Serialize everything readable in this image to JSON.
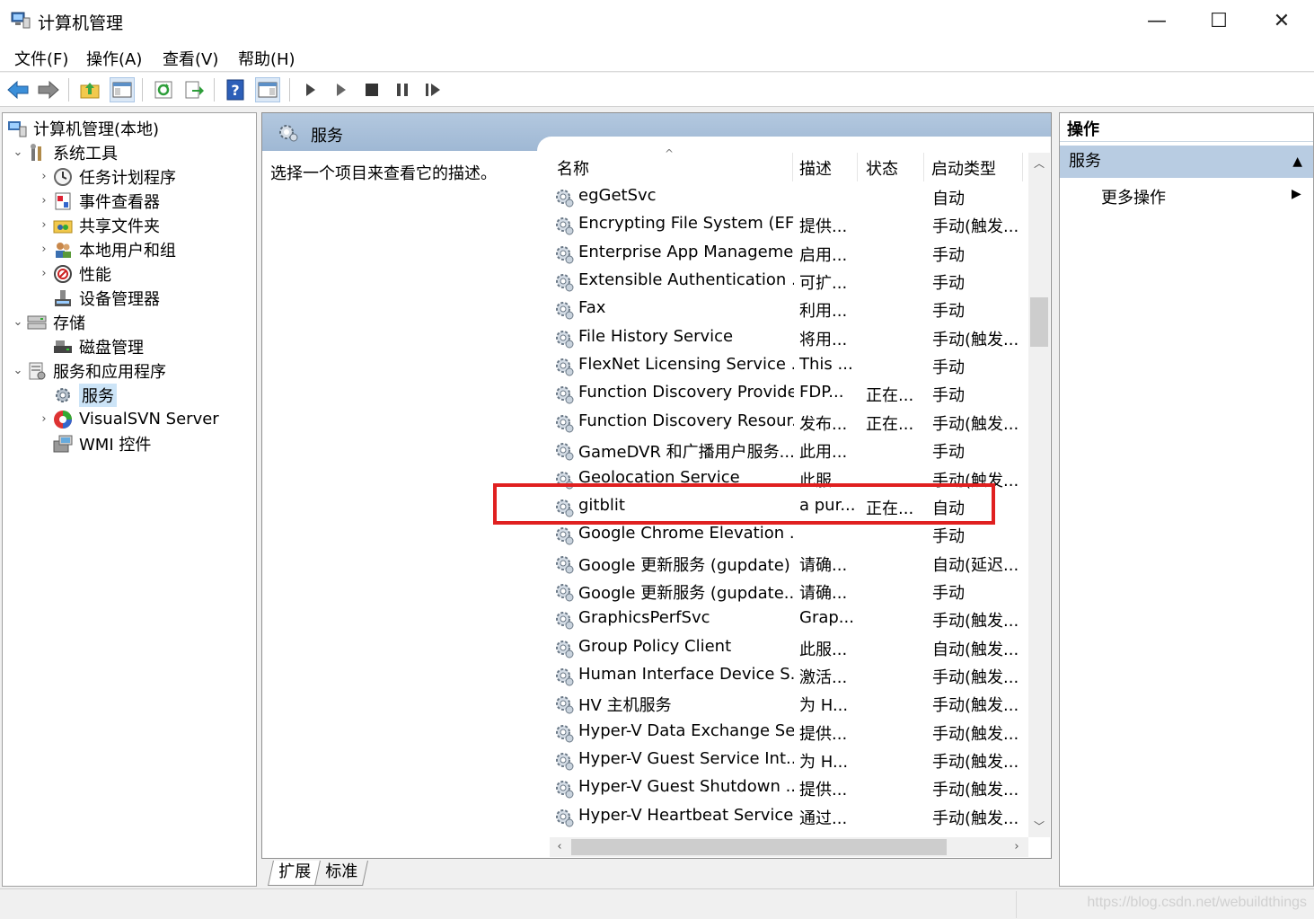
{
  "window": {
    "title": "计算机管理",
    "minimize": "—",
    "maximize": "☐",
    "close": "✕"
  },
  "menu": [
    "文件(F)",
    "操作(A)",
    "查看(V)",
    "帮助(H)"
  ],
  "tree": [
    {
      "label": "计算机管理(本地)",
      "icon": "computer-management-icon"
    },
    {
      "label": "系统工具",
      "icon": "tools-icon"
    },
    {
      "label": "任务计划程序",
      "icon": "clock-icon"
    },
    {
      "label": "事件查看器",
      "icon": "event-viewer-icon"
    },
    {
      "label": "共享文件夹",
      "icon": "shared-folder-icon"
    },
    {
      "label": "本地用户和组",
      "icon": "users-icon"
    },
    {
      "label": "性能",
      "icon": "performance-icon"
    },
    {
      "label": "设备管理器",
      "icon": "device-manager-icon"
    },
    {
      "label": "存储",
      "icon": "storage-icon"
    },
    {
      "label": "磁盘管理",
      "icon": "disk-icon"
    },
    {
      "label": "服务和应用程序",
      "icon": "services-apps-icon"
    },
    {
      "label": "服务",
      "icon": "gear-icon"
    },
    {
      "label": "VisualSVN Server",
      "icon": "visualsvn-icon"
    },
    {
      "label": "WMI 控件",
      "icon": "wmi-icon"
    }
  ],
  "center": {
    "header_title": "服务",
    "description": "选择一个项目来查看它的描述。",
    "columns": {
      "name": "名称",
      "desc": "描述",
      "status": "状态",
      "startup": "启动类型"
    },
    "rows": [
      {
        "name": "egGetSvc",
        "desc": "",
        "status": "",
        "startup": "自动"
      },
      {
        "name": "Encrypting File System (EFS)",
        "desc": "提供...",
        "status": "",
        "startup": "手动(触发..."
      },
      {
        "name": "Enterprise App Manageme...",
        "desc": "启用...",
        "status": "",
        "startup": "手动"
      },
      {
        "name": "Extensible Authentication ...",
        "desc": "可扩...",
        "status": "",
        "startup": "手动"
      },
      {
        "name": "Fax",
        "desc": "利用...",
        "status": "",
        "startup": "手动"
      },
      {
        "name": "File History Service",
        "desc": "将用...",
        "status": "",
        "startup": "手动(触发..."
      },
      {
        "name": "FlexNet Licensing Service ...",
        "desc": "This ...",
        "status": "",
        "startup": "手动"
      },
      {
        "name": "Function Discovery Provide...",
        "desc": "FDP...",
        "status": "正在...",
        "startup": "手动"
      },
      {
        "name": "Function Discovery Resour...",
        "desc": "发布...",
        "status": "正在...",
        "startup": "手动(触发..."
      },
      {
        "name": "GameDVR 和广播用户服务...",
        "desc": "此用...",
        "status": "",
        "startup": "手动"
      },
      {
        "name": "Geolocation Service",
        "desc": "此服...",
        "status": "",
        "startup": "手动(触发..."
      },
      {
        "name": "gitblit",
        "desc": "a pur...",
        "status": "正在...",
        "startup": "自动"
      },
      {
        "name": "Google Chrome Elevation ...",
        "desc": "",
        "status": "",
        "startup": "手动"
      },
      {
        "name": "Google 更新服务 (gupdate)",
        "desc": "请确...",
        "status": "",
        "startup": "自动(延迟..."
      },
      {
        "name": "Google 更新服务 (gupdate...",
        "desc": "请确...",
        "status": "",
        "startup": "手动"
      },
      {
        "name": "GraphicsPerfSvc",
        "desc": "Grap...",
        "status": "",
        "startup": "手动(触发..."
      },
      {
        "name": "Group Policy Client",
        "desc": "此服...",
        "status": "",
        "startup": "自动(触发..."
      },
      {
        "name": "Human Interface Device S...",
        "desc": "激活...",
        "status": "",
        "startup": "手动(触发..."
      },
      {
        "name": "HV 主机服务",
        "desc": "为 H...",
        "status": "",
        "startup": "手动(触发..."
      },
      {
        "name": "Hyper-V Data Exchange Se...",
        "desc": "提供...",
        "status": "",
        "startup": "手动(触发..."
      },
      {
        "name": "Hyper-V Guest Service Int...",
        "desc": "为 H...",
        "status": "",
        "startup": "手动(触发..."
      },
      {
        "name": "Hyper-V Guest Shutdown ...",
        "desc": "提供...",
        "status": "",
        "startup": "手动(触发..."
      },
      {
        "name": "Hyper-V Heartbeat Service",
        "desc": "通过...",
        "status": "",
        "startup": "手动(触发..."
      }
    ]
  },
  "tabs": [
    "扩展",
    "标准"
  ],
  "actions": {
    "title": "操作",
    "section": "服务",
    "more": "更多操作"
  },
  "watermark": "https://blog.csdn.net/webuildthings",
  "colors": {
    "highlight": "#e02020",
    "header": "#a8bfd9",
    "selection": "#cce4f7"
  }
}
